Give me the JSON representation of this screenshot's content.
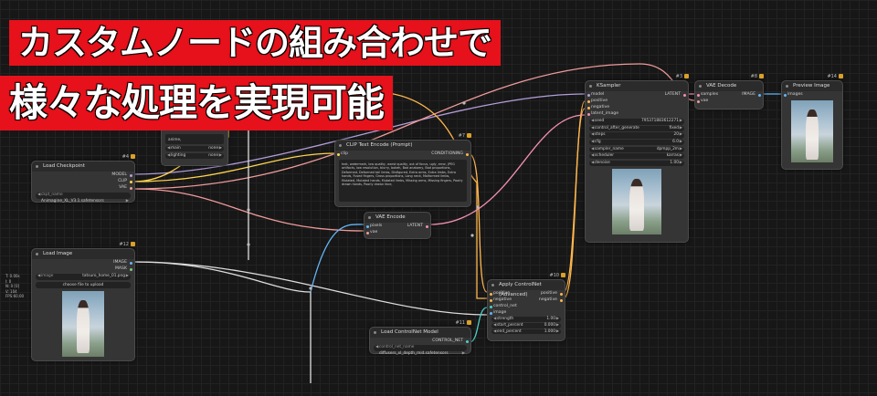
{
  "banner": {
    "line1": "カスタムノードの組み合わせで",
    "line2": "様々な処理を実現可能"
  },
  "colors": {
    "banner_bg": "#e6111b",
    "canvas_bg": "#171717",
    "node_bg": "#353535"
  },
  "sidebar_stats": [
    "T: 0.00s",
    "I: 0",
    "N: 0 [0]",
    "V: 104",
    "FPS:60.00"
  ],
  "nodes": {
    "partial": {
      "top_text": "anime,",
      "rows": [
        {
          "label": "main",
          "value": "none"
        },
        {
          "label": "lighting",
          "value": "none"
        }
      ]
    },
    "load_checkpoint": {
      "id": "#4",
      "title": "Load Checkpoint",
      "outputs": [
        "MODEL",
        "CLIP",
        "VAE"
      ],
      "ckpt_label": "ckpt_name",
      "ckpt_value": "Animagine_XL_V3.1.safetensors"
    },
    "load_image": {
      "id": "#12",
      "title": "Load Image",
      "outputs": [
        "IMAGE",
        "MASK"
      ],
      "image_label": "image",
      "image_value": "tatsuro_home_01.png",
      "upload_label": "choose file to upload"
    },
    "clip_text_encode": {
      "id": "#7",
      "title": "CLIP Text Encode (Prompt)",
      "input": "clip",
      "output": "CONDITIONING",
      "text": "text, watermark, low quality, worst quality, out of focus, ugly, error, JPEG artifacts, low resolution, blurry, bokeh, Bad anatomy, Bad proportions, Deformed, Deformed tail limbs, Disfigured, Extra arms, Extra limbs, Extra hands, Fused fingers, Gross proportions, Long neck, Malformed limbs, Mutated, Mutated hands, Mutated limbs, Missing arms, Missing fingers, Poorly drawn hands, Poorly drawn face,"
    },
    "vae_encode": {
      "id": "",
      "title": "VAE Encode",
      "inputs": [
        "pixels",
        "vae"
      ],
      "output": "LATENT"
    },
    "ksampler": {
      "id": "#3",
      "title": "KSampler",
      "inputs": [
        "model",
        "positive",
        "negative",
        "latent_image"
      ],
      "output": "LATENT",
      "widgets": [
        {
          "label": "seed",
          "value": "795371883612271"
        },
        {
          "label": "control_after_generate",
          "value": "fixed"
        },
        {
          "label": "steps",
          "value": "20"
        },
        {
          "label": "cfg",
          "value": "6.0"
        },
        {
          "label": "sampler_name",
          "value": "dpmpp_2m"
        },
        {
          "label": "scheduler",
          "value": "karras"
        },
        {
          "label": "denoise",
          "value": "1.00"
        }
      ]
    },
    "vae_decode": {
      "id": "#8",
      "title": "VAE Decode",
      "inputs": [
        "samples",
        "vae"
      ],
      "output": "IMAGE"
    },
    "preview_image": {
      "id": "#14",
      "title": "Preview Image",
      "inputs": [
        "images"
      ]
    },
    "apply_controlnet": {
      "id": "#10",
      "title": "Apply ControlNet (Advanced)",
      "inputs": [
        "positive",
        "negative",
        "control_net",
        "image"
      ],
      "outputs": [
        "positive",
        "negative"
      ],
      "widgets": [
        {
          "label": "strength",
          "value": "1.00"
        },
        {
          "label": "start_percent",
          "value": "0.000"
        },
        {
          "label": "end_percent",
          "value": "1.000"
        }
      ]
    },
    "load_controlnet": {
      "id": "#11",
      "title": "Load ControlNet Model",
      "output": "CONTROL_NET",
      "cn_label": "control_net_name",
      "cn_value": "diffusers_xl_depth_mid.safetensors"
    }
  }
}
